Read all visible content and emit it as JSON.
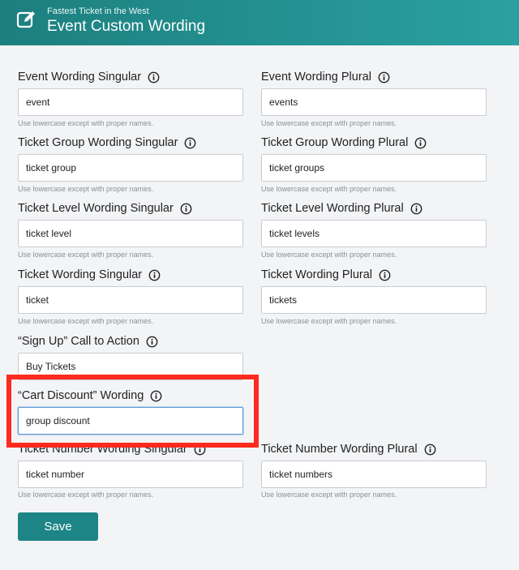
{
  "header": {
    "subtitle": "Fastest Ticket in the West",
    "title": "Event Custom Wording"
  },
  "fields": {
    "event_singular": {
      "label": "Event Wording Singular",
      "value": "event",
      "help": "Use lowercase except with proper names."
    },
    "event_plural": {
      "label": "Event Wording Plural",
      "value": "events",
      "help": "Use lowercase except with proper names."
    },
    "group_singular": {
      "label": "Ticket Group Wording Singular",
      "value": "ticket group",
      "help": "Use lowercase except with proper names."
    },
    "group_plural": {
      "label": "Ticket Group Wording Plural",
      "value": "ticket groups",
      "help": "Use lowercase except with proper names."
    },
    "level_singular": {
      "label": "Ticket Level Wording Singular",
      "value": "ticket level",
      "help": "Use lowercase except with proper names."
    },
    "level_plural": {
      "label": "Ticket Level Wording Plural",
      "value": "ticket levels",
      "help": "Use lowercase except with proper names."
    },
    "ticket_singular": {
      "label": "Ticket Wording Singular",
      "value": "ticket",
      "help": "Use lowercase except with proper names."
    },
    "ticket_plural": {
      "label": "Ticket Wording Plural",
      "value": "tickets",
      "help": "Use lowercase except with proper names."
    },
    "sign_up_cta": {
      "label": "“Sign Up” Call to Action",
      "value": "Buy Tickets"
    },
    "cart_discount": {
      "label": "“Cart Discount” Wording",
      "value": "group discount"
    },
    "number_singular": {
      "label": "Ticket Number Wording Singular",
      "value": "ticket number",
      "help": "Use lowercase except with proper names."
    },
    "number_plural": {
      "label": "Ticket Number Wording Plural",
      "value": "ticket numbers",
      "help": "Use lowercase except with proper names."
    }
  },
  "actions": {
    "save_label": "Save"
  },
  "colors": {
    "header_start": "#1d7f7f",
    "header_end": "#2aa0a0",
    "save_button": "#1d8585",
    "highlight": "#ff2a1f",
    "focus_border": "#5b9bd5"
  }
}
